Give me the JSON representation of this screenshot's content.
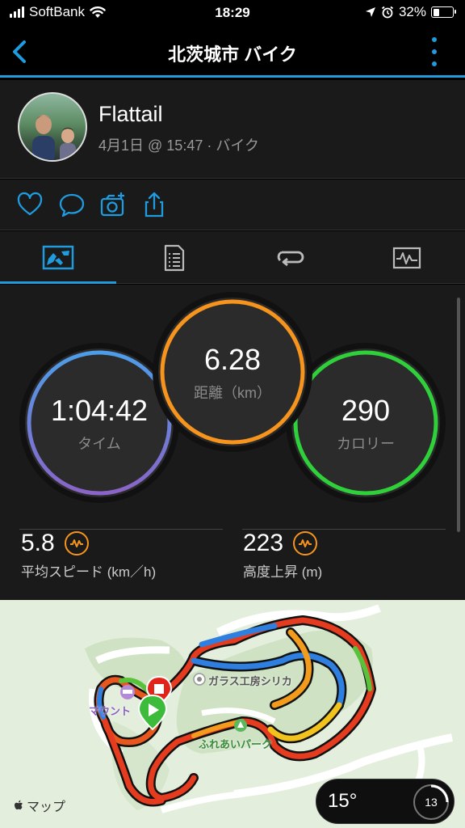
{
  "status_bar": {
    "carrier": "SoftBank",
    "time": "18:29",
    "battery": "32%",
    "battery_level": 0.32
  },
  "nav": {
    "title": "北茨城市 バイク"
  },
  "profile": {
    "name": "Flattail",
    "subtitle": "4月1日 @ 15:47 · バイク"
  },
  "actions": [
    "heart-icon",
    "comment-icon",
    "camera-add-icon",
    "share-icon"
  ],
  "tabs": [
    "stats-icon",
    "details-icon",
    "laps-icon",
    "charts-icon"
  ],
  "stats": {
    "time": {
      "value": "1:04:42",
      "label": "タイム"
    },
    "distance": {
      "value": "6.28",
      "label": "距離（km）"
    },
    "calories": {
      "value": "290",
      "label": "カロリー"
    },
    "avg_speed": {
      "value": "5.8",
      "label": "平均スピード (km／h)"
    },
    "elevation_gain": {
      "value": "223",
      "label": "高度上昇 (m)"
    },
    "colors": {
      "time_ring": "#5b8be0",
      "distance_ring": "#f7941d",
      "calories_ring": "#2fd13a"
    }
  },
  "map": {
    "labels": {
      "glass": "ガラス工房シリカ",
      "fureai": "ふれあいパーク",
      "mount": "マウント"
    },
    "temperature": "15°",
    "aqi": "13",
    "attribution": "マップ"
  }
}
